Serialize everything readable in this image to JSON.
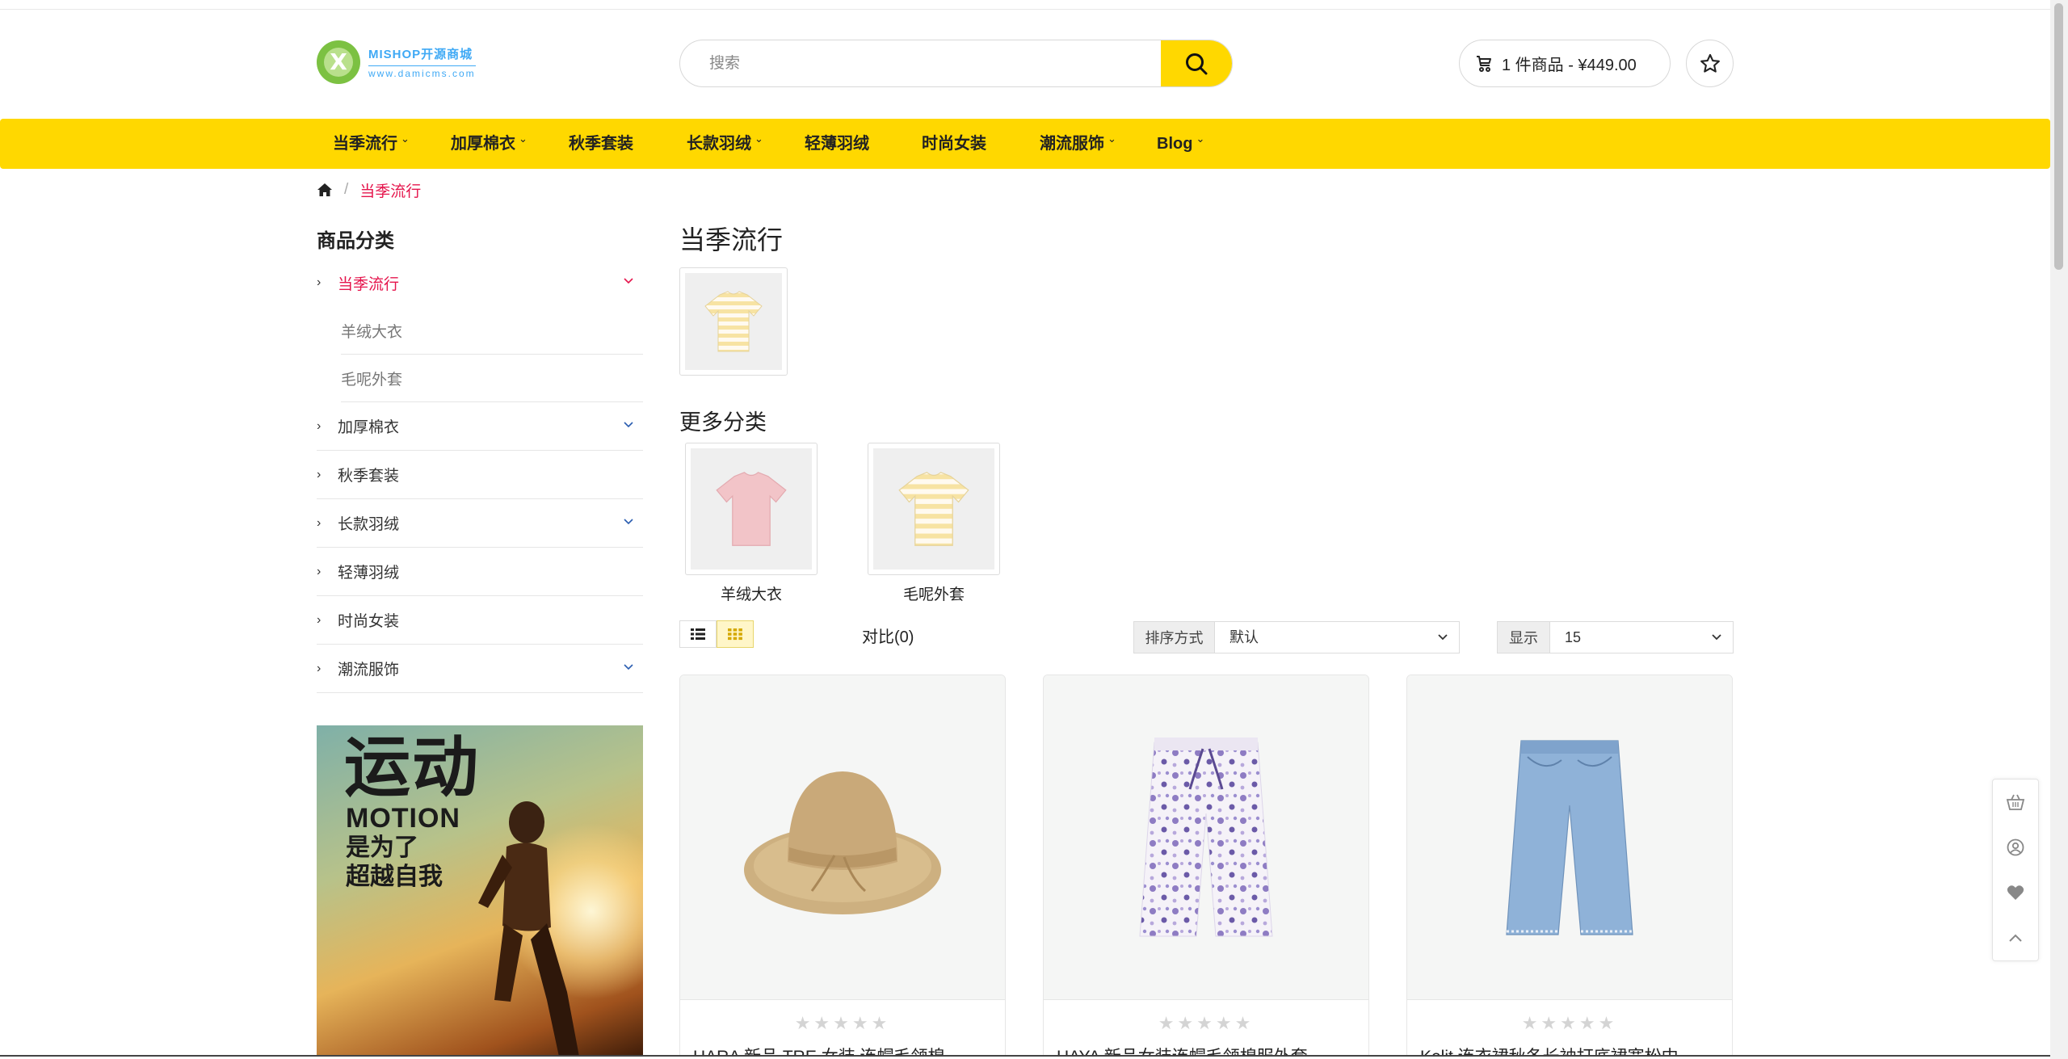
{
  "header": {
    "logo_name": "MISHOP开源商城",
    "logo_url": "www.damicms.com",
    "search_placeholder": "搜索",
    "cart_text": "1 件商品 - ¥449.00"
  },
  "nav": {
    "items": [
      {
        "label": "当季流行",
        "has_dropdown": true
      },
      {
        "label": "加厚棉衣",
        "has_dropdown": true
      },
      {
        "label": "秋季套装",
        "has_dropdown": false
      },
      {
        "label": "长款羽绒",
        "has_dropdown": true
      },
      {
        "label": "轻薄羽绒",
        "has_dropdown": false
      },
      {
        "label": "时尚女装",
        "has_dropdown": false
      },
      {
        "label": "潮流服饰",
        "has_dropdown": true
      },
      {
        "label": "Blog",
        "has_dropdown": true
      }
    ]
  },
  "breadcrumb": {
    "home_icon": "home-icon",
    "separator": "/",
    "current": "当季流行"
  },
  "sidebar": {
    "title": "商品分类",
    "categories": [
      {
        "label": "当季流行",
        "active": true,
        "expanded": true,
        "children": [
          "羊绒大衣",
          "毛呢外套"
        ]
      },
      {
        "label": "加厚棉衣",
        "has_children": true
      },
      {
        "label": "秋季套装",
        "has_children": false
      },
      {
        "label": "长款羽绒",
        "has_children": true
      },
      {
        "label": "轻薄羽绒",
        "has_children": false
      },
      {
        "label": "时尚女装",
        "has_children": false
      },
      {
        "label": "潮流服饰",
        "has_children": true
      }
    ],
    "banner": {
      "line1": "运动",
      "line2": "MOTION",
      "line3": "是为了",
      "line4": "超越自我"
    }
  },
  "main": {
    "title": "当季流行",
    "more_title": "更多分类",
    "subcategories": [
      {
        "label": "羊绒大衣"
      },
      {
        "label": "毛呢外套"
      }
    ],
    "toolbar": {
      "compare": "对比(0)",
      "sort_label": "排序方式",
      "sort_value": "默认",
      "show_label": "显示",
      "show_value": "15"
    },
    "products": [
      {
        "name": "HARA 新品 TRE 女装 连帽毛领棉",
        "rating": 0
      },
      {
        "name": "HAYA 新品女装连帽毛领棉服外套",
        "rating": 0
      },
      {
        "name": "Kelit 连衣裙秋冬长袖打底裙宽松中",
        "rating": 0
      }
    ]
  },
  "colors": {
    "accent": "#ffd800",
    "active_red": "#e5154c"
  }
}
